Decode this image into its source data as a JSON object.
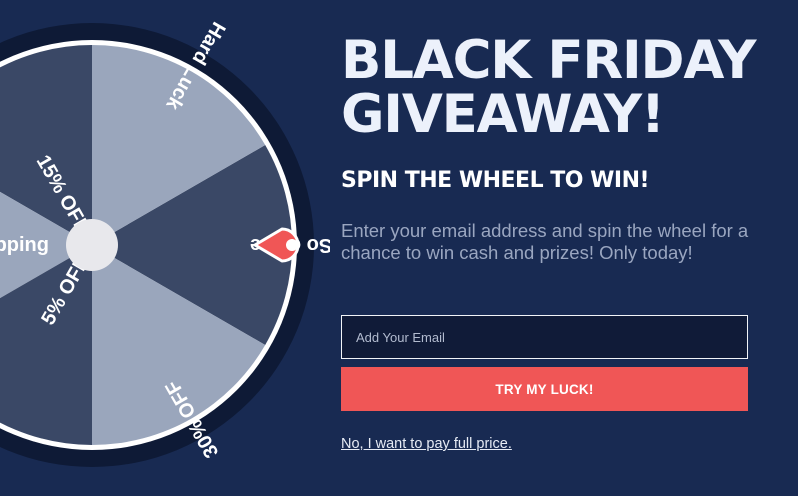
{
  "popup": {
    "title_line1": "BLACK FRIDAY",
    "title_line2": "GIVEAWAY!",
    "subtitle": "SPIN THE WHEEL TO WIN!",
    "description": "Enter your email address and spin the wheel for a chance to win cash and prizes! Only today!",
    "email_placeholder": "Add Your Email",
    "email_value": "",
    "cta_label": "TRY MY LUCK!",
    "decline_label": "No, I want to pay full price."
  },
  "wheel": {
    "segments": [
      {
        "label": "So close"
      },
      {
        "label": "30% OFF"
      },
      {
        "label": "15% OFF"
      },
      {
        "label": "pping"
      },
      {
        "label": "5% OFF"
      },
      {
        "label": "Hard Luck"
      }
    ],
    "pointer_icon": "map-pin-icon"
  },
  "colors": {
    "background": "#182a52",
    "wheel_light": "#9aa6bc",
    "wheel_dark": "#3a4866",
    "wheel_rim": "#0e1a36",
    "accent": "#f05656",
    "title": "#ecf1fb"
  }
}
